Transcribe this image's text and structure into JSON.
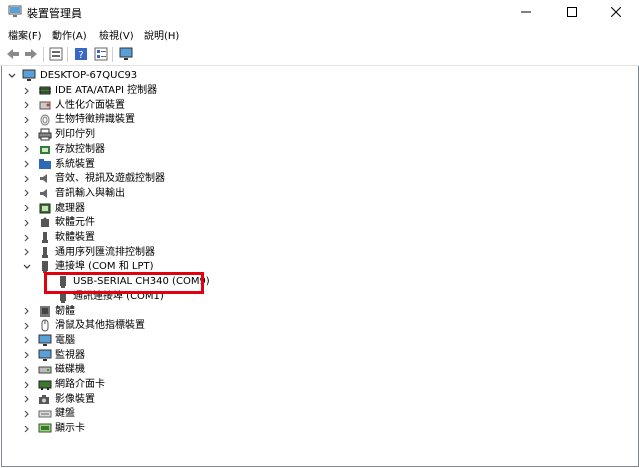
{
  "window": {
    "title": "裝置管理員"
  },
  "menu": {
    "file": "檔案(F)",
    "action": "動作(A)",
    "view": "檢視(V)",
    "help": "說明(H)"
  },
  "tree": {
    "root": "DESKTOP-67QUC93",
    "categories": [
      "IDE ATA/ATAPI 控制器",
      "人性化介面裝置",
      "生物特徵辨識裝置",
      "列印佇列",
      "存放控制器",
      "系統裝置",
      "音效、視訊及遊戲控制器",
      "音訊輸入與輸出",
      "處理器",
      "軟體元件",
      "軟體裝置",
      "通用序列匯流排控制器",
      "連接埠 (COM 和 LPT)",
      "USB-SERIAL CH340 (COM9)",
      "通訊連接埠 (COM1)",
      "韌體",
      "滑鼠及其他指標裝置",
      "電腦",
      "監視器",
      "磁碟機",
      "網路介面卡",
      "影像裝置",
      "鍵盤",
      "顯示卡"
    ]
  }
}
